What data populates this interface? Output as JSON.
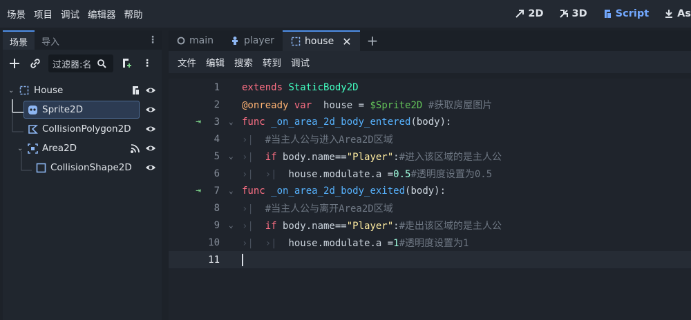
{
  "menu": [
    "场景",
    "项目",
    "调试",
    "编辑器",
    "帮助"
  ],
  "modes": [
    {
      "label": "2D",
      "icon": "2d-mode-icon",
      "active": false
    },
    {
      "label": "3D",
      "icon": "3d-mode-icon",
      "active": false
    },
    {
      "label": "Script",
      "icon": "script-mode-icon",
      "active": true
    },
    {
      "label": "As",
      "icon": "assetlib-mode-icon",
      "active": false
    }
  ],
  "dock": {
    "tabs": [
      "场景",
      "导入"
    ],
    "filter_text": "过滤器:名",
    "tree": [
      {
        "label": "House",
        "icon": "node2d-icon",
        "indent": 0,
        "extra": "script-icon"
      },
      {
        "label": "Sprite2D",
        "icon": "sprite2d-icon",
        "indent": 1,
        "selected": true
      },
      {
        "label": "CollisionPolygon2D",
        "icon": "collisionpolygon2d-icon",
        "indent": 1
      },
      {
        "label": "Area2D",
        "icon": "area2d-icon",
        "indent": 1,
        "extra": "signal-icon"
      },
      {
        "label": "CollisionShape2D",
        "icon": "collisionshape2d-icon",
        "indent": 2
      }
    ]
  },
  "editor": {
    "tabs": [
      "main",
      "player",
      "house"
    ],
    "active_tab": "house",
    "menu": [
      "文件",
      "编辑",
      "搜索",
      "转到",
      "调试"
    ],
    "current_line": 11
  },
  "colors": {
    "accent": "#4f8fe8",
    "keyword": "#ff7085",
    "class": "#42ffc2",
    "function": "#57b3ff",
    "string": "#ffeda1",
    "comment": "#6f7884"
  }
}
